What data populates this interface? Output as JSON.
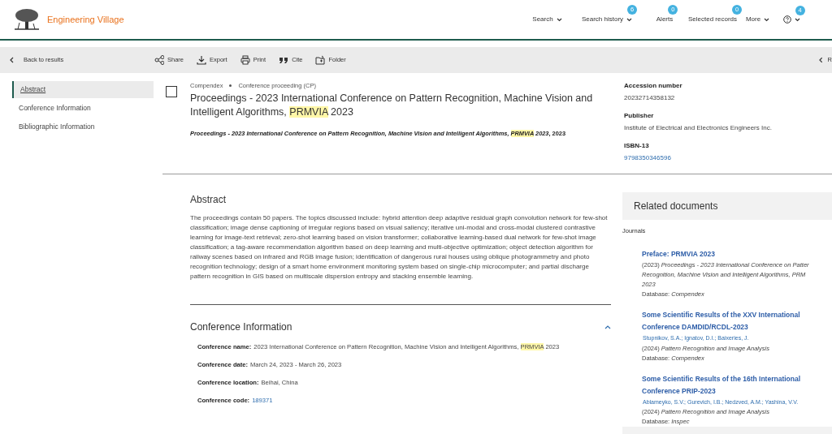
{
  "header": {
    "brand": "Engineering Village",
    "nav": [
      {
        "label": "Search",
        "dropdown": true,
        "kind": "text"
      },
      {
        "label": "Search history",
        "dropdown": true,
        "badge": "6",
        "kind": "text"
      },
      {
        "label": "Alerts",
        "dropdown": false,
        "badge": "0",
        "kind": "text"
      },
      {
        "label": "Selected records",
        "dropdown": false,
        "badge": "0",
        "kind": "text"
      },
      {
        "label": "More",
        "dropdown": true,
        "kind": "text"
      },
      {
        "dropdown": true,
        "badge": "4",
        "kind": "help"
      }
    ]
  },
  "toolbar": {
    "back": "Back to results",
    "actions": [
      {
        "label": "Share",
        "kind": "share"
      },
      {
        "label": "Export",
        "kind": "export"
      },
      {
        "label": "Print",
        "kind": "print"
      },
      {
        "label": "Cite",
        "kind": "cite"
      },
      {
        "label": "Folder",
        "kind": "folder"
      }
    ],
    "next": "R"
  },
  "sidebar": {
    "items": [
      {
        "label": "Abstract",
        "selected": true
      },
      {
        "label": "Conference Information",
        "selected": false
      },
      {
        "label": "Bibliographic Information",
        "selected": false
      }
    ]
  },
  "record": {
    "checked": false,
    "database": "Compendex",
    "doc_type": "Conference proceeding (CP)",
    "title": [
      {
        "text": "Proceedings - 2023 International Conference on Pattern Recognition, Machine Vision and Intelligent Algorithms, ",
        "highlighted": false
      },
      {
        "text": "PRMVIA",
        "highlighted": true
      },
      {
        "text": " 2023",
        "highlighted": false
      }
    ],
    "source": [
      {
        "text": "Proceedings - 2023 International Conference on Pattern Recognition, Machine Vision and Intelligent Algorithms, ",
        "highlighted": false
      },
      {
        "text": "PRMVIA",
        "highlighted": true
      },
      {
        "text": " 2023",
        "highlighted": false
      }
    ],
    "source_year": ", 2023"
  },
  "meta": [
    {
      "label": "Accession number",
      "value": "20232714358132",
      "link": false
    },
    {
      "label": "Publisher",
      "value": "Institute of Electrical and Electronics Engineers Inc.",
      "link": false
    },
    {
      "label": "ISBN-13",
      "value": "9798350346596",
      "link": true
    }
  ],
  "abstract": {
    "heading": "Abstract",
    "text": "The proceedings contain 50 papers. The topics discussed include: hybrid attention deep adaptive residual graph convolution network for few-shot classification; image dense captioning of irregular regions based on visual saliency; iterative uni-modal and cross-modal clustered contrastive learning for image-text retrieval; zero-shot learning based on vision transformer; collaborative learning-based dual network for few-shot image classification; a tag-aware recommendation algorithm based on deep learning and multi-objective optimization; object detection algorithm for railway scenes based on infrared and RGB image fusion; identification of dangerous rural houses using oblique photogrammetry and photo recognition technology; design of a smart home environment monitoring system based on single-chip microcomputer; and partial discharge pattern recognition in GIS based on multiscale dispersion entropy and stacking ensemble learning."
  },
  "conference": {
    "heading": "Conference Information",
    "expanded": true,
    "fields": [
      {
        "label": "Conference name:",
        "value": [
          {
            "text": "2023 International Conference on Pattern Recognition, Machine Vision and Intelligent Algorithms, ",
            "highlighted": false
          },
          {
            "text": "PRMVIA",
            "highlighted": true
          },
          {
            "text": " 2023",
            "highlighted": false
          }
        ],
        "link": false
      },
      {
        "label": "Conference date:",
        "value": [
          {
            "text": "March 24, 2023 - March 26, 2023",
            "highlighted": false
          }
        ],
        "link": false
      },
      {
        "label": "Conference location:",
        "value": [
          {
            "text": "Beihai, China",
            "highlighted": false
          }
        ],
        "link": false
      },
      {
        "label": "Conference code:",
        "value": [
          {
            "text": "189371",
            "highlighted": false
          }
        ],
        "link": true
      }
    ]
  },
  "related": {
    "heading": "Related documents",
    "group": "Journals",
    "docs": [
      {
        "title": "Preface: PRMVIA 2023",
        "source_lines": [
          "(2023) *Proceedings - 2023 International Conference on Patter*",
          "*Recognition, Machine Vision and Intelligent Algorithms, PRM*",
          "*2023*"
        ],
        "database": "Database: *Compendex*"
      },
      {
        "title": "Some Scientific Results of the XXV International Conference DAMDID/RCDL-2023",
        "authors": "Stupnikov, S.A.; Ignatov, D.I.; Baixeries, J.",
        "source_lines": [
          "(2024) *Pattern Recognition and Image Analysis*"
        ],
        "database": "Database: *Compendex*"
      },
      {
        "title": "Some Scientific Results of the 16th International Conference PRIP-2023",
        "authors": "Ablameyko, S.V.; Gurevich, I.B.; Nedzved, A.M.; Yashina, V.V.",
        "source_lines": [
          "(2024) *Pattern Recognition and Image Analysis*"
        ],
        "database": "Database: *Inspec*"
      }
    ]
  }
}
